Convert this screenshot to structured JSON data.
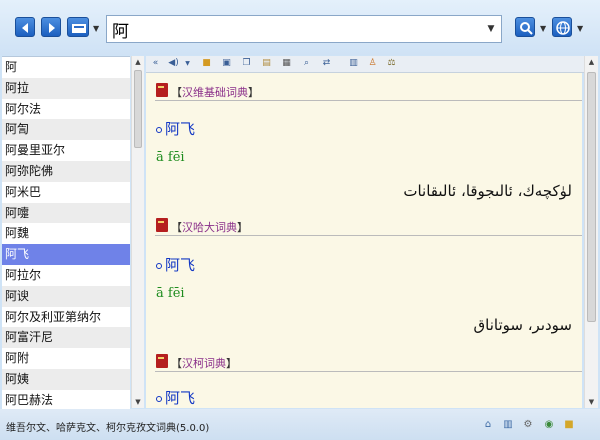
{
  "search": {
    "value": "阿"
  },
  "word_list": [
    "阿",
    "阿拉",
    "阿尔法",
    "阿訇",
    "阿曼里亚尔",
    "阿弥陀佛",
    "阿米巴",
    "阿嚏",
    "阿魏",
    "阿飞",
    "阿拉尔",
    "阿谀",
    "阿尔及利亚第纳尔",
    "阿富汗尼",
    "阿附",
    "阿姨",
    "阿巴赫法"
  ],
  "selected_word": "阿飞",
  "toolbar_icons": [
    "back-icon",
    "forward-icon",
    "dictionary-select-icon",
    "search-icon",
    "globe-icon"
  ],
  "content_tool_icons": [
    "collapse-icon",
    "speaker-icon",
    "folder-icon",
    "save-icon",
    "copy-icon",
    "paste-icon",
    "print-icon",
    "find-icon",
    "swap-icon",
    "book-icon",
    "person-icon",
    "scale-icon"
  ],
  "entries": [
    {
      "dictionary": "汉维基础词典",
      "headword": "阿飞",
      "pinyin": "ā fēi",
      "translation": "لۈكچەك، ئالىجوقا، ئالىقانات"
    },
    {
      "dictionary": "汉哈大词典",
      "headword": "阿飞",
      "pinyin": "ā fēi",
      "translation": "سودىر، سوتاناق"
    },
    {
      "dictionary": "汉柯词典",
      "headword": "阿飞"
    }
  ],
  "status": {
    "text": "维吾尔文、哈萨克文、柯尔克孜文词典(5.0.0)"
  },
  "status_icons": [
    "home-icon",
    "book-icon",
    "settings-icon",
    "network-icon",
    "lock-icon"
  ],
  "colors": {
    "selection": "#6f82e8",
    "headword": "#1237c4",
    "pinyin": "#1e8c1e",
    "dictionary_name": "#8a2f8a",
    "content_bg": "#fbf8e6"
  }
}
